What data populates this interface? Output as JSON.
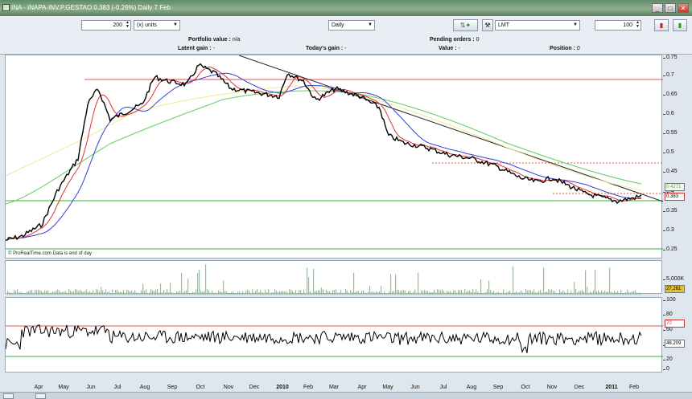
{
  "title": "INA - INAPA-INV.P.GESTAO    0.383 (-0.26%)    Daily  7 Feb",
  "window": {
    "min": "_",
    "max": "□",
    "close": "✕"
  },
  "toolbar": {
    "quantity": "200",
    "units": "(x) units",
    "period": "Daily",
    "order_type": "LMT",
    "order_qty": "100",
    "portfolio_label": "Portfolio value :",
    "portfolio_value": "n/a",
    "latent_label": "Latent gain :",
    "latent_value": "-",
    "today_label": "Today's gain :",
    "today_value": "-",
    "pending_label": "Pending orders :",
    "pending_value": "0",
    "value_label": "Value :",
    "value_value": "-",
    "position_label": "Position :",
    "position_value": "0"
  },
  "icons": {
    "scale": "chart-scale-icon",
    "wrench": "wrench-icon",
    "buy": "buy-icon",
    "sell": "sell-icon"
  },
  "source_note": "© ProRealTime.com  Data is end of day",
  "price_axis": {
    "ticks": [
      "0.75",
      "0.7",
      "0.65",
      "0.6",
      "0.55",
      "0.5",
      "0.45",
      "0.4",
      "0.35",
      "0.3",
      "0.25"
    ],
    "badges": [
      "0.4271",
      "0.383"
    ]
  },
  "volume_axis": {
    "ticks": [
      "5,000K"
    ],
    "badge": "27,261"
  },
  "rsi_axis": {
    "ticks": [
      "100",
      "80",
      "60",
      "40",
      "20",
      "0"
    ],
    "badges": [
      "70",
      "46.209"
    ]
  },
  "x_axis": [
    "Apr",
    "May",
    "Jun",
    "Jul",
    "Aug",
    "Sep",
    "Oct",
    "Nov",
    "Dec",
    "2010",
    "Feb",
    "Mar",
    "Apr",
    "May",
    "Jun",
    "Jul",
    "Aug",
    "Sep",
    "Oct",
    "Nov",
    "Dec",
    "2011",
    "Feb"
  ],
  "colors": {
    "price": "#000000",
    "ma_short": "#e03030",
    "ma_mid": "#3040d0",
    "ma_long": "#60d060",
    "ma_longest": "#e8e880",
    "trendline": "#222222",
    "level_red": "#e05050",
    "level_green": "#30b030",
    "volume": "#7ad07a"
  }
}
